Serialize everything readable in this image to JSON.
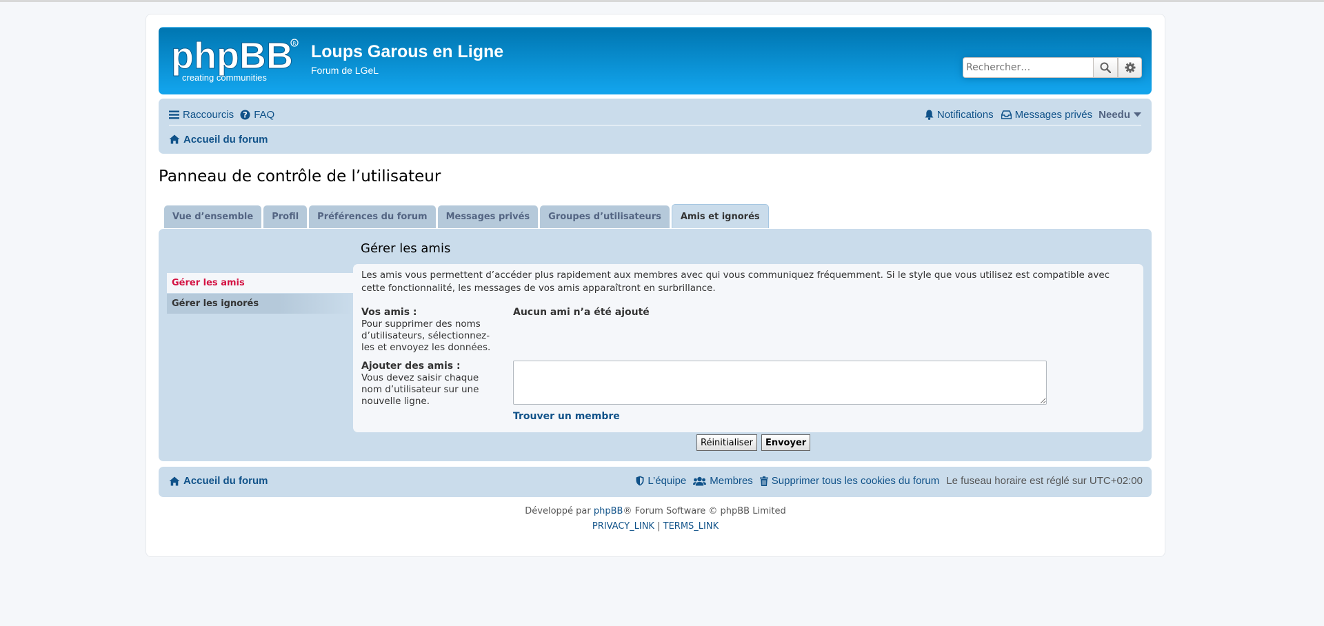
{
  "site": {
    "title": "Loups Garous en Ligne",
    "description": "Forum de LGeL",
    "logo_text": "phpBB",
    "logo_tagline": "creating communities"
  },
  "search": {
    "placeholder": "Rechercher…",
    "icons": [
      "search-icon",
      "gear-icon"
    ]
  },
  "navbar": {
    "quicklinks": "Raccourcis",
    "faq": "FAQ",
    "notifications": "Notifications",
    "private_messages": "Messages privés",
    "username": "Needu",
    "breadcrumb_home": "Accueil du forum"
  },
  "page": {
    "title": "Panneau de contrôle de l’utilisateur"
  },
  "tabs": [
    {
      "label": "Vue d’ensemble",
      "active": false
    },
    {
      "label": "Profil",
      "active": false
    },
    {
      "label": "Préférences du forum",
      "active": false
    },
    {
      "label": "Messages privés",
      "active": false
    },
    {
      "label": "Groupes d’utilisateurs",
      "active": false
    },
    {
      "label": "Amis et ignorés",
      "active": true
    }
  ],
  "sidebar": {
    "items": [
      {
        "label": "Gérer les amis",
        "active": true
      },
      {
        "label": "Gérer les ignorés",
        "active": false
      }
    ]
  },
  "main": {
    "section_title": "Gérer les amis",
    "intro": "Les amis vous permettent d’accéder plus rapidement aux membres avec qui vous communiquez fréquemment. Si le style que vous utilisez est compatible avec cette fonctionnalité, les messages de vos amis apparaîtront en surbrillance.",
    "your_friends_label": "Vos amis :",
    "your_friends_help": "Pour supprimer des noms d’utilisateurs, sélectionnez-les et envoyez les données.",
    "your_friends_value": "Aucun ami n’a été ajouté",
    "add_friends_label": "Ajouter des amis :",
    "add_friends_help": "Vous devez saisir chaque nom d’utilisateur sur une nouvelle ligne.",
    "add_friends_value": "",
    "find_member": "Trouver un membre",
    "reset_label": "Réinitialiser",
    "submit_label": "Envoyer"
  },
  "footer": {
    "home": "Accueil du forum",
    "team": "L’équipe",
    "members": "Membres",
    "delete_cookies": "Supprimer tous les cookies du forum",
    "timezone": "Le fuseau horaire est réglé sur UTC+02:00",
    "powered_prefix": "Développé par ",
    "powered_link": "phpBB",
    "powered_suffix": "® Forum Software © phpBB Limited",
    "privacy": "PRIVACY_LINK",
    "separator": "|",
    "terms": "TERMS_LINK"
  },
  "colors": {
    "header_blue": "#12a3eb",
    "nav_bg": "#cadceb",
    "link": "#105289",
    "active_red": "#d31141"
  }
}
